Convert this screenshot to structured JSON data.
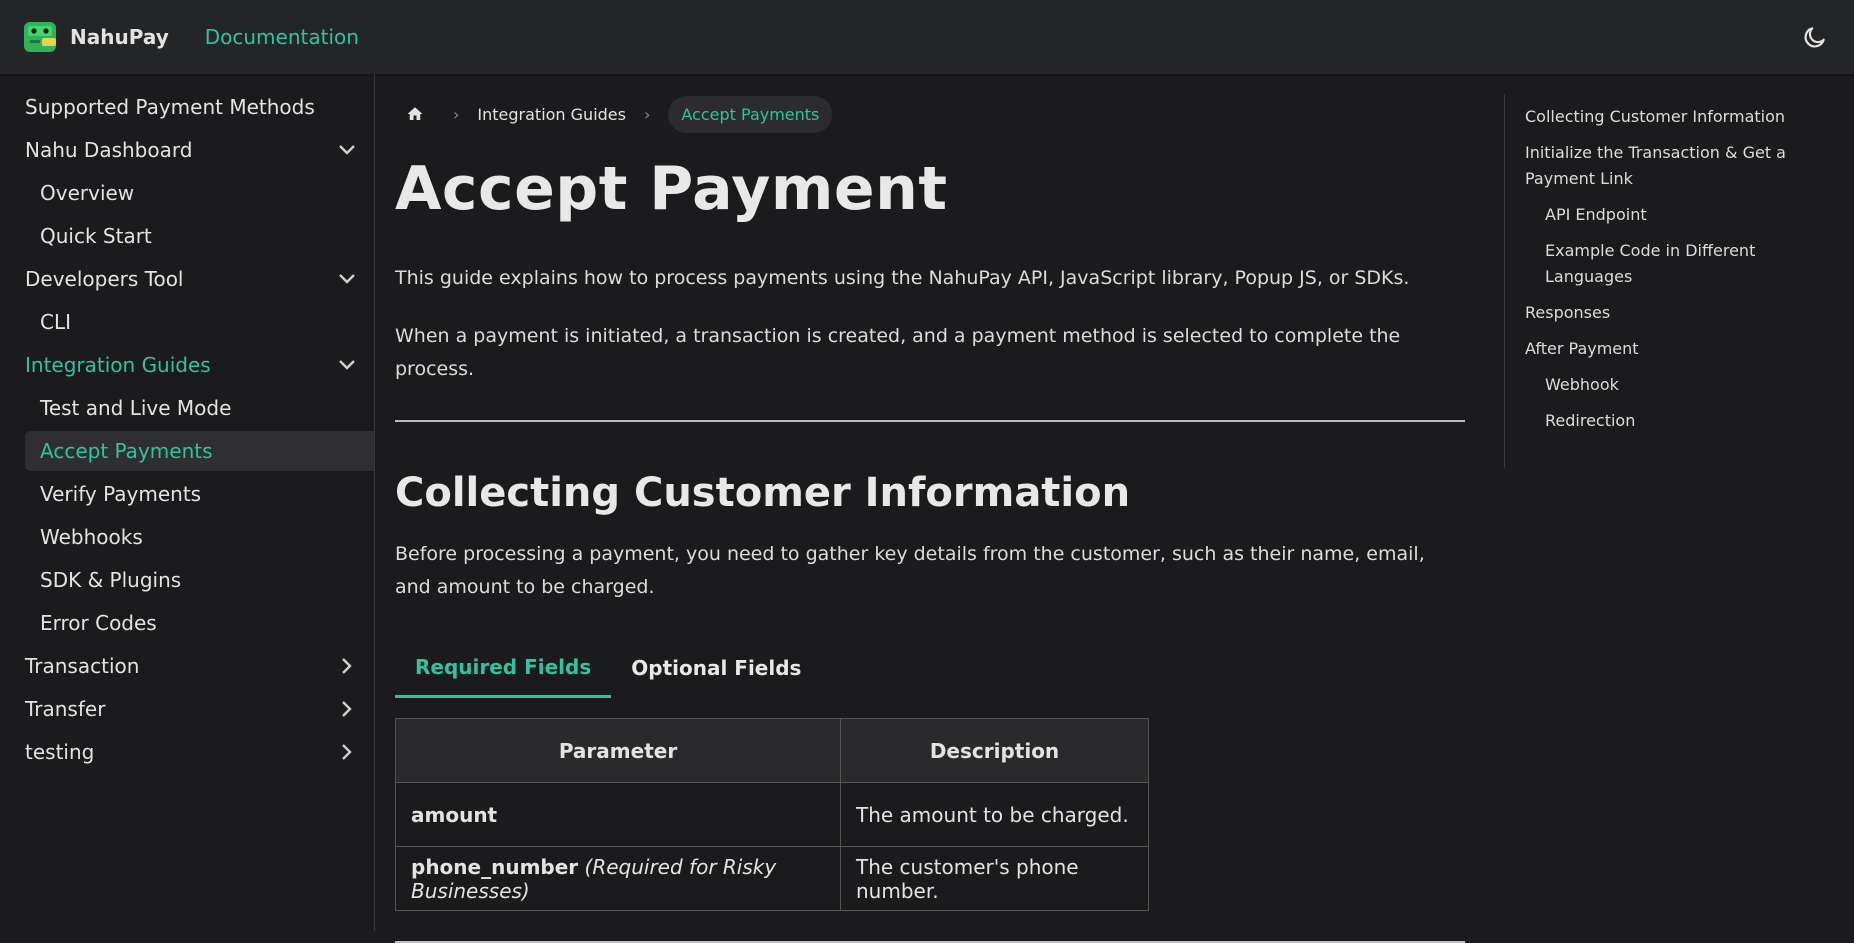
{
  "navbar": {
    "brand": "NahuPay",
    "doc_link": "Documentation"
  },
  "sidebar": {
    "items": [
      {
        "label": "Supported Payment Methods"
      },
      {
        "label": "Nahu Dashboard"
      },
      {
        "label": "Overview"
      },
      {
        "label": "Quick Start"
      },
      {
        "label": "Developers Tool"
      },
      {
        "label": "CLI"
      },
      {
        "label": "Integration Guides"
      },
      {
        "label": "Test and Live Mode"
      },
      {
        "label": "Accept Payments"
      },
      {
        "label": "Verify Payments"
      },
      {
        "label": "Webhooks"
      },
      {
        "label": "SDK & Plugins"
      },
      {
        "label": "Error Codes"
      },
      {
        "label": "Transaction"
      },
      {
        "label": "Transfer"
      },
      {
        "label": "testing"
      }
    ]
  },
  "breadcrumb": {
    "parent": "Integration Guides",
    "current": "Accept Payments"
  },
  "main": {
    "title": "Accept Payment",
    "intro1": "This guide explains how to process payments using the NahuPay API, JavaScript library, Popup JS, or SDKs.",
    "intro2": "When a payment is initiated, a transaction is created, and a payment method is selected to complete the process.",
    "section_title": "Collecting Customer Information",
    "section_body": "Before processing a payment, you need to gather key details from the customer, such as their name, email, and amount to be charged.",
    "tabs": [
      {
        "label": "Required Fields"
      },
      {
        "label": "Optional Fields"
      }
    ],
    "table": {
      "headers": [
        "Parameter",
        "Description"
      ],
      "rows": [
        {
          "name": "amount",
          "note": "",
          "description": "The amount to be charged."
        },
        {
          "name": "phone_number",
          "note": "(Required for Risky Businesses)",
          "description": "The customer's phone number."
        }
      ]
    }
  },
  "toc": {
    "items": [
      {
        "label": "Collecting Customer Information"
      },
      {
        "label": "Initialize the Transaction & Get a Payment Link"
      },
      {
        "label": "API Endpoint"
      },
      {
        "label": "Example Code in Different Languages"
      },
      {
        "label": "Responses"
      },
      {
        "label": "After Payment"
      },
      {
        "label": "Webhook"
      },
      {
        "label": "Redirection"
      }
    ]
  },
  "colors": {
    "accent": "#2ec4a0",
    "background": "#1b1b1d",
    "navbar": "#242526"
  }
}
